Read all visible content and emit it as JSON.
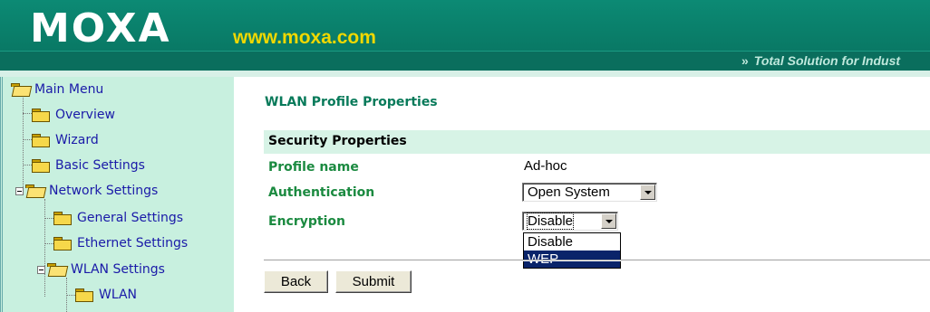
{
  "header": {
    "brand": "MOXA",
    "url": "www.moxa.com",
    "tagline": "Total Solution for Indust",
    "tagline_icon": "double-chevron-right-icon"
  },
  "menu": {
    "items": [
      {
        "label": "Main Menu"
      },
      {
        "label": "Overview"
      },
      {
        "label": "Wizard"
      },
      {
        "label": "Basic Settings"
      },
      {
        "label": "Network Settings"
      },
      {
        "label": "General Settings"
      },
      {
        "label": "Ethernet Settings"
      },
      {
        "label": "WLAN Settings"
      },
      {
        "label": "WLAN"
      }
    ]
  },
  "main": {
    "page_title": "WLAN Profile Properties",
    "section_title": "Security Properties",
    "fields": {
      "profile_name": {
        "label": "Profile name",
        "value": "Ad-hoc"
      },
      "authentication": {
        "label": "Authentication",
        "value": "Open System"
      },
      "encryption": {
        "label": "Encryption",
        "value": "Disable",
        "options": [
          "Disable",
          "WEP"
        ],
        "highlighted": "WEP"
      }
    },
    "buttons": {
      "back": "Back",
      "submit": "Submit"
    }
  },
  "colors": {
    "banner": "#097a66",
    "brand_url": "#f0d800",
    "menu_bg": "#c8f0df",
    "menu_link": "#1a1aa8",
    "title": "#087a5a",
    "label": "#1b8a40",
    "section_bar": "#d7f3e6",
    "option_highlight": "#0a246a"
  }
}
